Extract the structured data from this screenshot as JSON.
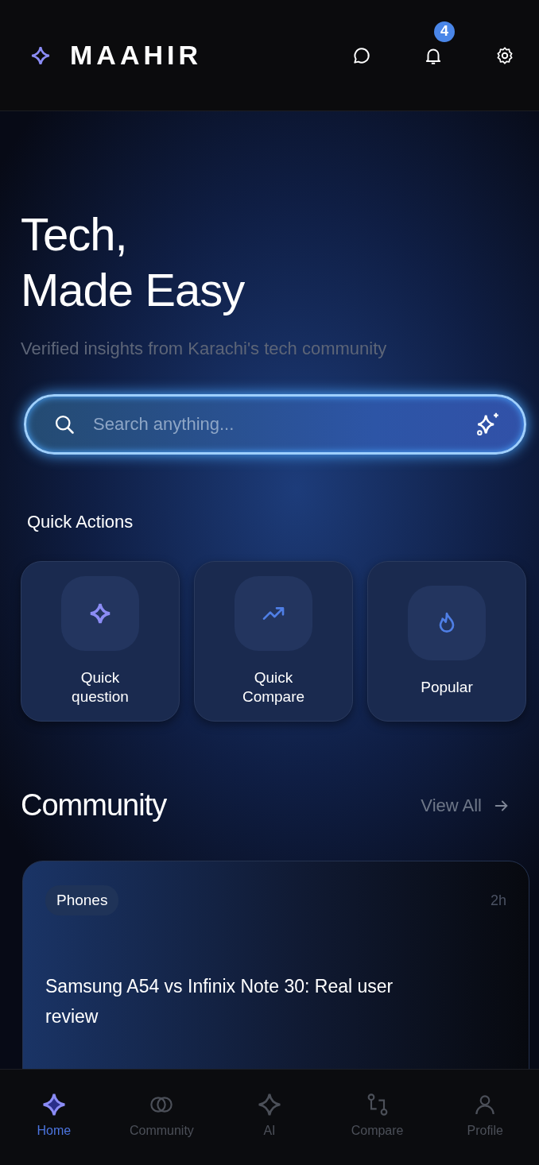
{
  "header": {
    "brand": "MAAHIR",
    "notification_count": "4"
  },
  "hero": {
    "title_lines": [
      "Tech,",
      "Made Easy"
    ],
    "subtitle": "Verified insights from Karachi's tech community"
  },
  "search": {
    "placeholder": "Search anything..."
  },
  "quick_actions": {
    "title": "Quick Actions",
    "items": [
      {
        "kind": "sparkle",
        "label": "Quick question"
      },
      {
        "kind": "trend",
        "label": "Quick Compare"
      },
      {
        "kind": "flame",
        "label": "Popular"
      }
    ]
  },
  "community": {
    "title": "Community",
    "view_all": "View All",
    "posts": [
      {
        "tag": "Phones",
        "time": "2h",
        "title": "Samsung A54 vs Infinix Note 30: Real user review"
      }
    ]
  },
  "nav": [
    {
      "kind": "home",
      "label": "Home",
      "selected": true
    },
    {
      "kind": "community",
      "label": "Community",
      "selected": false
    },
    {
      "kind": "ai",
      "label": "AI",
      "selected": false
    },
    {
      "kind": "compare",
      "label": "Compare",
      "selected": false
    },
    {
      "kind": "profile",
      "label": "Profile",
      "selected": false
    }
  ]
}
